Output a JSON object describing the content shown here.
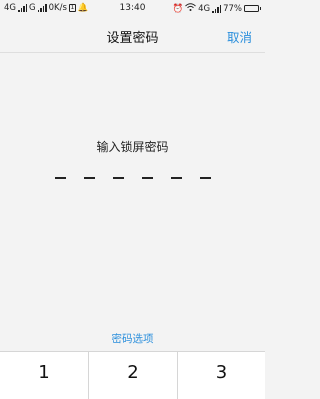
{
  "status_bar": {
    "net1": "4G",
    "net2": "G",
    "speed": "0K/s",
    "time": "13:40",
    "net3": "4G",
    "battery": "77%",
    "battery_level": 0.77
  },
  "header": {
    "title": "设置密码",
    "cancel_label": "取消"
  },
  "prompt": "输入锁屏密码",
  "pin_slots": 6,
  "options_label": "密码选项",
  "keypad": {
    "keys": [
      "1",
      "2",
      "3"
    ]
  }
}
